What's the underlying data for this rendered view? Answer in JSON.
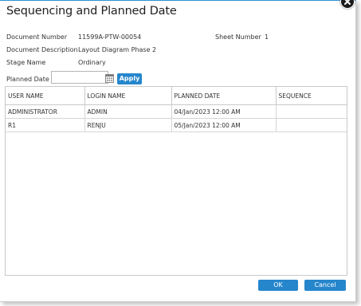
{
  "dialog": {
    "title": "Sequencing and Planned Date",
    "close_icon": "close-icon"
  },
  "info": {
    "document_number_label": "Document Number",
    "document_number_value": "11599A-PTW-00054",
    "sheet_number_label": "Sheet Number",
    "sheet_number_value": "1",
    "document_description_label": "Document Description",
    "document_description_value": "Layout Diagram Phase 2",
    "stage_name_label": "Stage Name",
    "stage_name_value": "Ordinary"
  },
  "planned_date": {
    "label": "Planned Date :",
    "value": "",
    "calendar_icon": "calendar-icon",
    "apply_label": "Apply"
  },
  "table": {
    "columns": [
      "USER NAME",
      "LOGIN NAME",
      "PLANNED DATE",
      "SEQUENCE"
    ],
    "rows": [
      [
        "ADMINISTRATOR",
        "ADMIN",
        "04/Jan/2023 12:00 AM",
        ""
      ],
      [
        "R1",
        "RENJU",
        "05/Jan/2023 12:00 AM",
        ""
      ]
    ]
  },
  "footer": {
    "ok_label": "OK",
    "cancel_label": "Cancel"
  },
  "colors": {
    "accent": "#2686cc",
    "title_bar_border": "#2f8fd8"
  }
}
